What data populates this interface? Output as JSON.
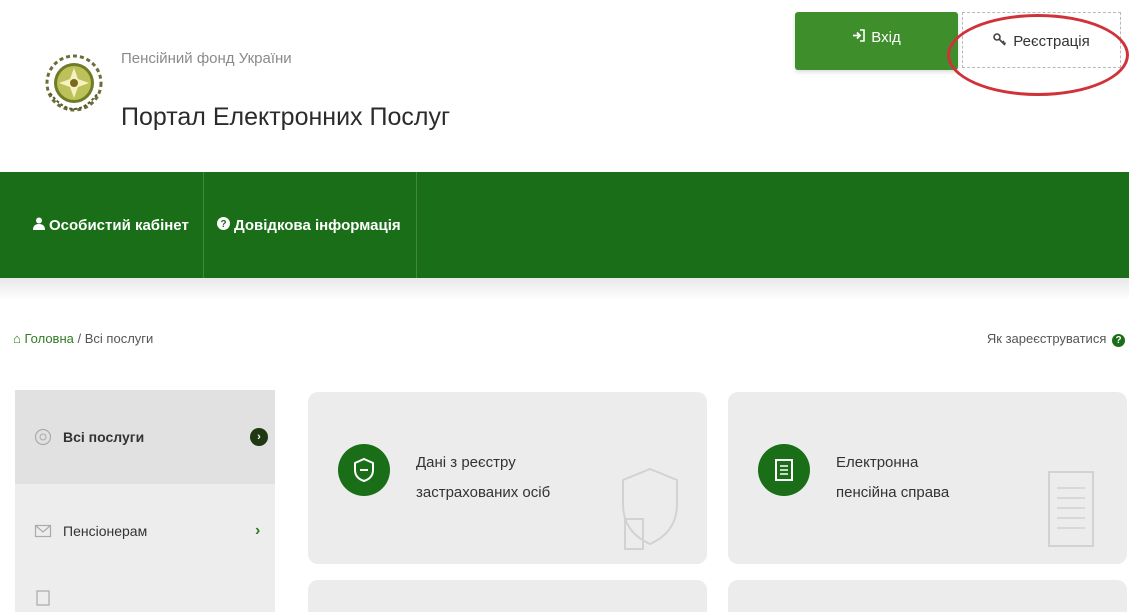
{
  "header": {
    "subtitle": "Пенсійний фонд України",
    "title": "Портал Електронних Послуг",
    "login_label": "Вхід",
    "register_label": "Реєстрація"
  },
  "nav": {
    "items": [
      {
        "label": "Особистий кабінет",
        "icon": "user-icon"
      },
      {
        "label": "Довідкова інформація",
        "icon": "question-icon"
      }
    ]
  },
  "breadcrumb": {
    "home": "Головна",
    "separator": "/",
    "current": "Всі послуги"
  },
  "howto": {
    "label": "Як зареєструватися"
  },
  "sidebar": {
    "items": [
      {
        "label": "Всі послуги",
        "active": true
      },
      {
        "label": "Пенсіонерам",
        "active": false
      },
      {
        "label": "",
        "active": false
      }
    ]
  },
  "cards": [
    {
      "line1": "Дані з реєстру",
      "line2": "застрахованих осіб",
      "icon": "registry-shield-icon"
    },
    {
      "line1": "Електронна",
      "line2": "пенсійна справа",
      "icon": "document-icon"
    }
  ],
  "colors": {
    "brand_green": "#1a6e17",
    "button_green": "#3f8e2c",
    "highlight_red": "#d0323a"
  }
}
